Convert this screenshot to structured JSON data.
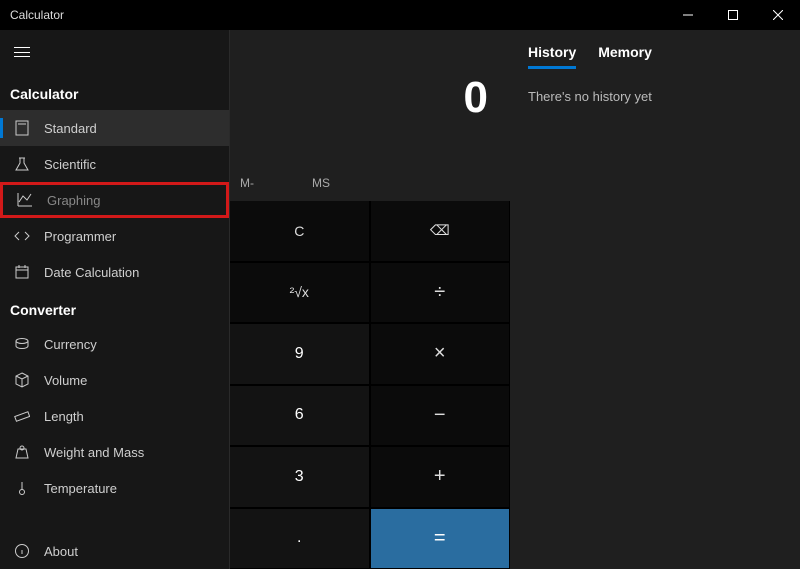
{
  "titlebar": {
    "title": "Calculator"
  },
  "sidebar": {
    "calc_head": "Calculator",
    "conv_head": "Converter",
    "items": {
      "standard": "Standard",
      "scientific": "Scientific",
      "graphing": "Graphing",
      "programmer": "Programmer",
      "datecalc": "Date Calculation",
      "currency": "Currency",
      "volume": "Volume",
      "length": "Length",
      "weight": "Weight and Mass",
      "temperature": "Temperature",
      "about": "About"
    }
  },
  "center": {
    "display": "0",
    "memory": {
      "mminus": "M-",
      "ms": "MS"
    },
    "keys": {
      "c": "C",
      "back": "⌫",
      "root": "²√x",
      "div": "÷",
      "k9": "9",
      "mul": "×",
      "k6": "6",
      "sub": "−",
      "k3": "3",
      "add": "+",
      "dot": ".",
      "eq": "="
    }
  },
  "right": {
    "tabs": {
      "history": "History",
      "memory": "Memory"
    },
    "empty": "There's no history yet"
  }
}
